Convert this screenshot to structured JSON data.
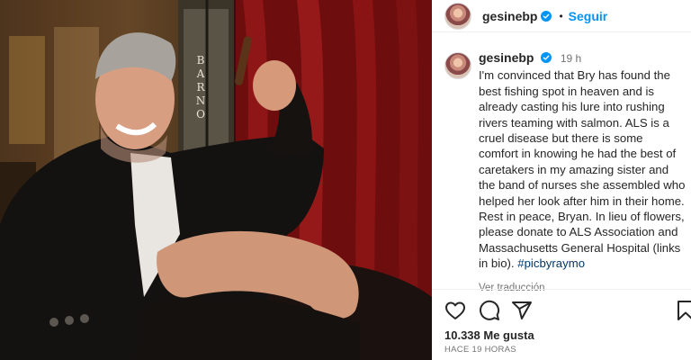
{
  "post": {
    "username": "gesinebp",
    "follow_label": "Seguir",
    "separator": "•",
    "caption_time": "19 h",
    "caption_text": "I'm convinced that Bry has found the best fishing spot in heaven and is already casting his lure into rushing rivers teaming with salmon. ALS is a cruel disease but there is some comfort in knowing he had the best of caretakers in my amazing sister and the band of nurses she assembled who helped her look after him in their home. Rest in peace, Bryan. In lieu of flowers, please donate to ALS Association and Massachusetts General Hospital (links in bio).",
    "hashtag": "#picbyraymo",
    "see_translation": "Ver traducción",
    "likes": "10.338 Me gusta",
    "time_ago": "HACE 19 HORAS"
  },
  "photo": {
    "sign_text": "BARNO"
  },
  "icons": {
    "verified": "verified-badge-icon",
    "like": "heart-icon",
    "comment": "comment-bubble-icon",
    "share": "paper-plane-icon",
    "save": "bookmark-icon"
  },
  "colors": {
    "accent": "#0095f6",
    "verified": "#0095f6",
    "text": "#262626",
    "muted": "#737373",
    "hashtag": "#00376b"
  }
}
